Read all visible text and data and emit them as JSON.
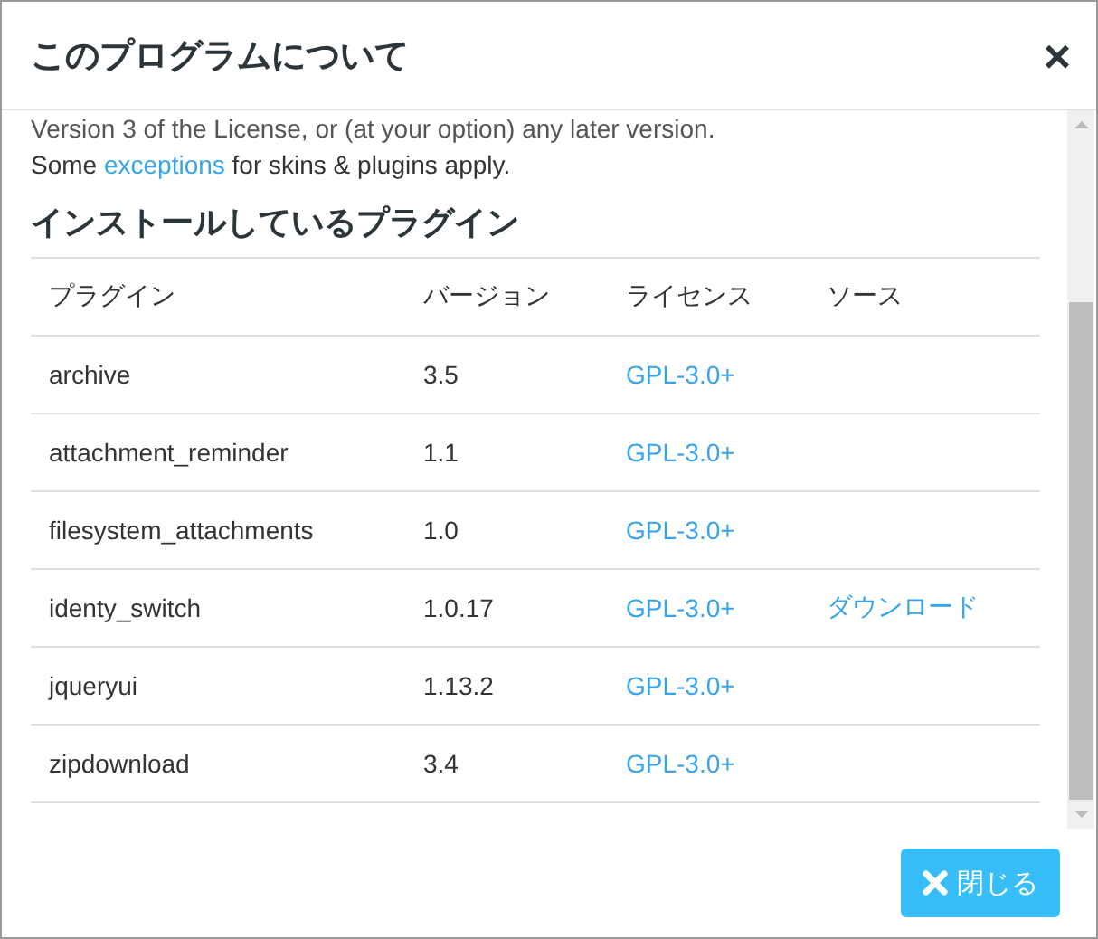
{
  "dialog": {
    "title": "このプログラムについて",
    "close_icon": "×"
  },
  "license": {
    "cut_line": "Version 3 of the License, or (at your option) any later version.",
    "before_link": "Some ",
    "link": "exceptions",
    "after_link": " for skins & plugins apply."
  },
  "plugins": {
    "heading": "インストールしているプラグイン",
    "columns": [
      "プラグイン",
      "バージョン",
      "ライセンス",
      "ソース"
    ],
    "rows": [
      {
        "name": "archive",
        "version": "3.5",
        "license": "GPL-3.0+"
      },
      {
        "name": "attachment_reminder",
        "version": "1.1",
        "license": "GPL-3.0+"
      },
      {
        "name": "filesystem_attachments",
        "version": "1.0",
        "license": "GPL-3.0+"
      },
      {
        "name": "identy_switch",
        "version": "1.0.17",
        "license": "GPL-3.0+",
        "source": "ダウンロード"
      },
      {
        "name": "jqueryui",
        "version": "1.13.2",
        "license": "GPL-3.0+"
      },
      {
        "name": "zipdownload",
        "version": "3.4",
        "license": "GPL-3.0+"
      }
    ]
  },
  "footer": {
    "close_button": "閉じる"
  }
}
